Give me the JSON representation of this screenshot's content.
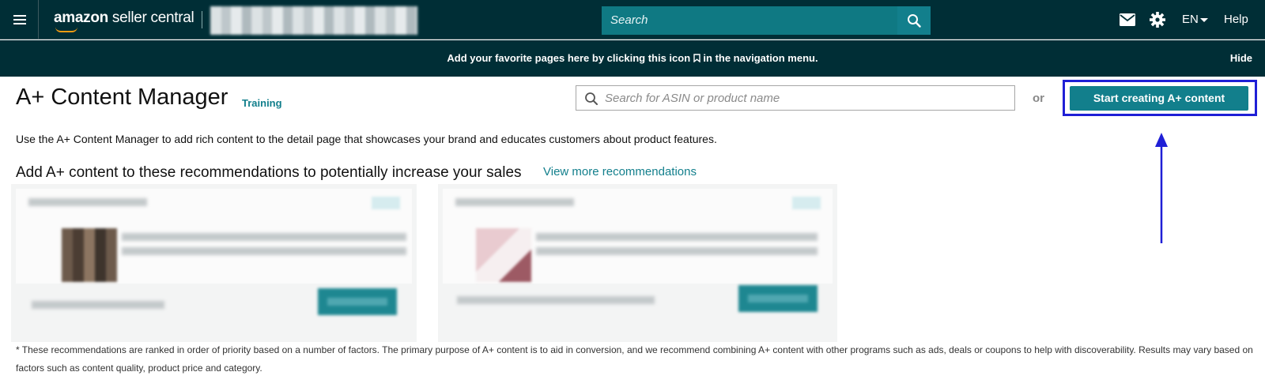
{
  "topnav": {
    "logo_brand": "amazon",
    "logo_product": " seller central",
    "search_placeholder": "Search",
    "language": "EN",
    "help_label": "Help"
  },
  "favorites_bar": {
    "message_before_icon": "Add your favorite pages here by clicking this icon",
    "message_after_icon": "in the navigation menu.",
    "hide_label": "Hide"
  },
  "page": {
    "title": "A+ Content Manager",
    "training_link": "Training",
    "asin_search_placeholder": "Search for ASIN or product name",
    "or_label": "or",
    "cta_label": "Start creating A+ content",
    "description": "Use the A+ Content Manager to add rich content to the detail page that showcases your brand and educates customers about product features.",
    "recommendations_heading": "Add A+ content to these recommendations to potentially increase your sales",
    "view_more_label": "View more recommendations",
    "footnote": "* These recommendations are ranked in order of priority based on a number of factors. The primary purpose of A+ content is to aid in conversion, and we recommend combining A+ content with other programs such as ads, deals or coupons to help with discoverability. Results may vary based on factors such as content quality, product price and category."
  },
  "colors": {
    "nav_bg": "#002e36",
    "accent": "#127f8c",
    "annotation": "#1f1fd6"
  },
  "icons": [
    "menu-icon",
    "search-icon",
    "mail-icon",
    "gear-icon",
    "caret-down-icon",
    "bookmark-icon",
    "arrow-up-icon"
  ]
}
